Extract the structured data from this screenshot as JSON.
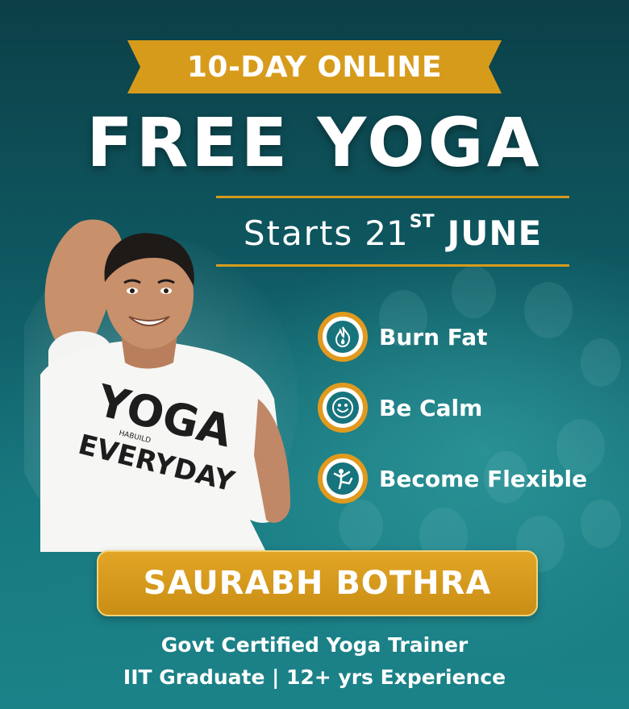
{
  "ribbon": {
    "text": "10-DAY ONLINE",
    "color": "#d79b1c"
  },
  "title": "FREE YOGA",
  "start": {
    "word": "Starts",
    "day": "21",
    "suffix": "ST",
    "month": "JUNE"
  },
  "benefits": [
    {
      "label": "Burn Fat",
      "icon": "flame-icon"
    },
    {
      "label": "Be Calm",
      "icon": "smiley-icon"
    },
    {
      "label": "Become Flexible",
      "icon": "yoga-pose-icon"
    }
  ],
  "trainer": {
    "name": "SAURABH BOTHRA",
    "credential_1": "Govt Certified Yoga Trainer",
    "credential_2": "IIT Graduate | 12+ yrs Experience"
  },
  "shirt": {
    "line1": "YOGA",
    "brand": "HABUILD",
    "line2": "EVERYDAY"
  },
  "colors": {
    "accent": "#d79b1c",
    "background": "#0f5a63",
    "icon_fill": "#17747d"
  }
}
